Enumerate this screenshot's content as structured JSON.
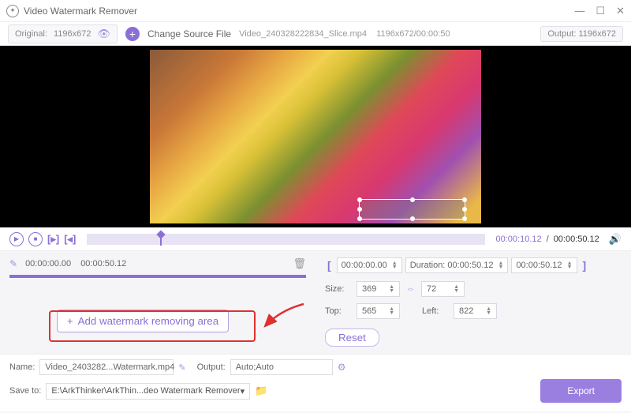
{
  "app": {
    "title": "Video Watermark Remover"
  },
  "toolbar": {
    "original_label": "Original:",
    "original_dims": "1196x672",
    "change_label": "Change Source File",
    "filename": "Video_240328222834_Slice.mp4",
    "src_dims": "1196x672",
    "src_dur": "00:00:50",
    "output_label": "Output:",
    "output_dims": "1196x672"
  },
  "playbar": {
    "time_current": "00:00:10.12",
    "time_total": "00:00:50.12"
  },
  "segment": {
    "start": "00:00:00.00",
    "end": "00:00:50.12",
    "add_label": "Add watermark removing area"
  },
  "props": {
    "t_start": "00:00:00.00",
    "t_dur_label": "Duration:",
    "t_dur": "00:00:50.12",
    "t_end": "00:00:50.12",
    "size_label": "Size:",
    "size_w": "369",
    "size_h": "72",
    "top_label": "Top:",
    "top_v": "565",
    "left_label": "Left:",
    "left_v": "822",
    "reset_label": "Reset"
  },
  "bottom": {
    "name_label": "Name:",
    "name_value": "Video_2403282...Watermark.mp4",
    "output_label": "Output:",
    "output_value": "Auto;Auto",
    "saveto_label": "Save to:",
    "saveto_value": "E:\\ArkThinker\\ArkThin...deo Watermark Remover",
    "export_label": "Export"
  }
}
